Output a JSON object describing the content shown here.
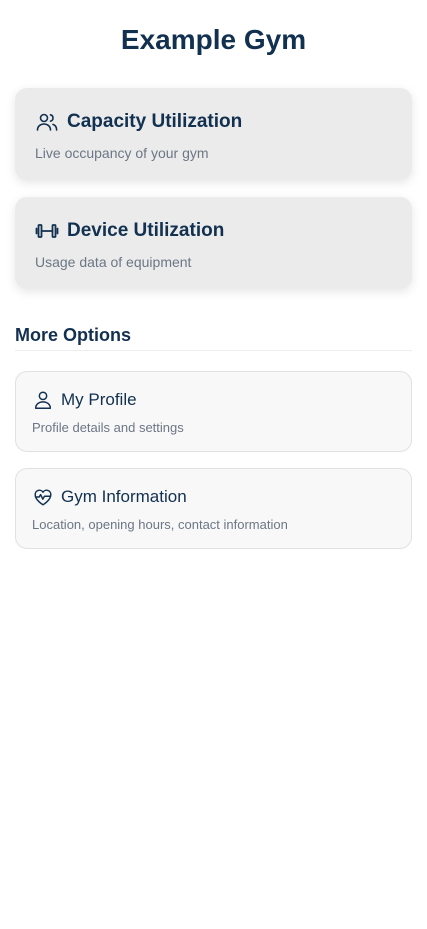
{
  "header": {
    "title": "Example Gym"
  },
  "primary_cards": [
    {
      "title": "Capacity Utilization",
      "subtitle": "Live occupancy of your gym",
      "icon": "users-icon"
    },
    {
      "title": "Device Utilization",
      "subtitle": "Usage data of equipment",
      "icon": "dumbbell-icon"
    }
  ],
  "more_options": {
    "heading": "More Options",
    "items": [
      {
        "title": "My Profile",
        "subtitle": "Profile details and settings",
        "icon": "user-icon"
      },
      {
        "title": "Gym Information",
        "subtitle": "Location, opening hours, contact information",
        "icon": "heart-pulse-icon"
      }
    ]
  },
  "colors": {
    "primary_text": "#12304f",
    "secondary_text": "#6b7785",
    "primary_card_bg": "#ebebeb",
    "option_card_bg": "#f8f8f8",
    "option_card_border": "#e1e1e1"
  }
}
